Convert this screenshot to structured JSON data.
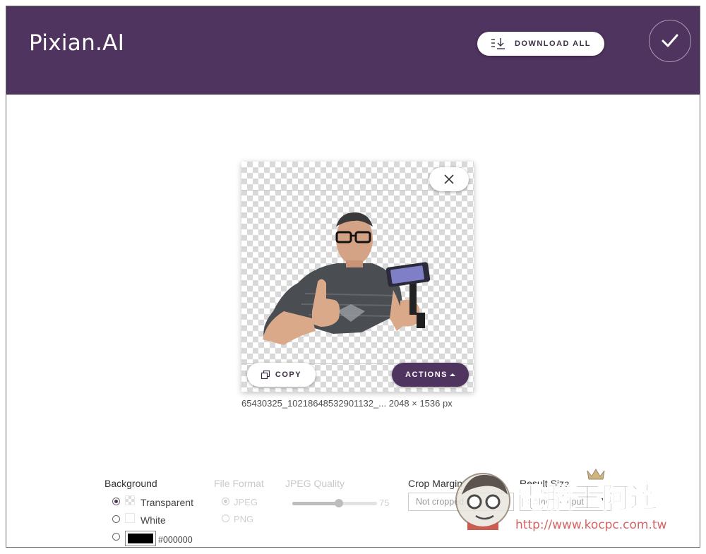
{
  "app": {
    "brand": "Pixian.AI"
  },
  "header": {
    "download_all_label": "DOWNLOAD ALL"
  },
  "preview": {
    "copy_label": "COPY",
    "actions_label": "ACTIONS",
    "filename": "65430325_10218648532901132_...",
    "dimensions": "2048 × 1536 px"
  },
  "options": {
    "background": {
      "label": "Background",
      "choices": [
        "Transparent",
        "White"
      ],
      "selected": "Transparent",
      "custom_color": "#000000"
    },
    "file_format": {
      "label": "File Format",
      "choices": [
        "JPEG",
        "PNG"
      ],
      "selected": "JPEG"
    },
    "jpeg_quality": {
      "label": "JPEG Quality",
      "value": "75",
      "fraction": 0.55
    },
    "crop_margin": {
      "label": "Crop Margin",
      "value": "Not cropped"
    },
    "result_size": {
      "label": "Result Size",
      "value": "Same as input"
    }
  },
  "watermark": {
    "title": "電腦王阿達",
    "url": "http://www.kocpc.com.tw"
  },
  "colors": {
    "header_bg": "#503460",
    "accent": "#503460"
  }
}
